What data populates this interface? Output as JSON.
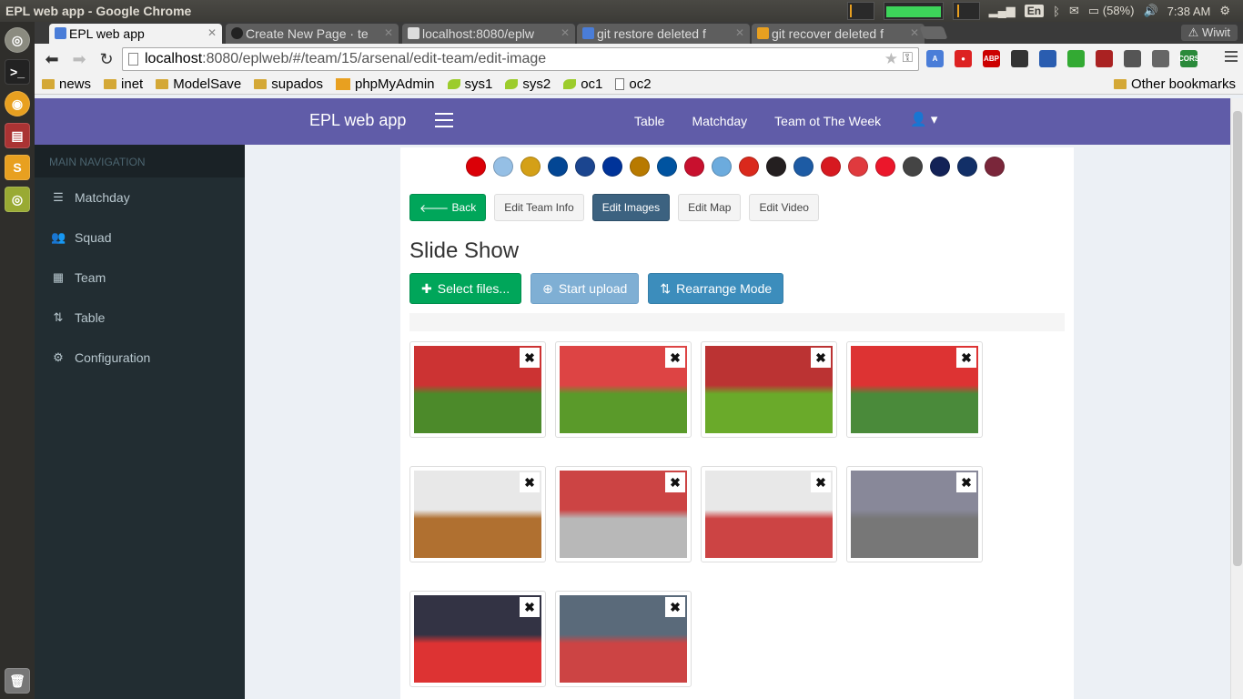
{
  "os": {
    "window_title": "EPL web app - Google Chrome",
    "lang": "En",
    "battery": "(58%)",
    "time": "7:38 AM"
  },
  "browser": {
    "tabs": [
      {
        "label": "EPL web app",
        "favicon_color": "#4a7dd8",
        "active": true
      },
      {
        "label": "Create New Page · te",
        "favicon_color": "#222222",
        "active": false
      },
      {
        "label": "localhost:8080/eplw",
        "favicon_color": "#dddddd",
        "active": false
      },
      {
        "label": "git restore deleted f",
        "favicon_color": "#4a7dd8",
        "active": false
      },
      {
        "label": "git recover deleted f",
        "favicon_color": "#e8a020",
        "active": false
      }
    ],
    "wiwit": "Wiwit",
    "url_host": "localhost",
    "url_rest": ":8080/eplweb/#/team/15/arsenal/edit-team/edit-image",
    "extensions": [
      {
        "name": "translate-icon",
        "color": "#4a7dd8",
        "text": "A"
      },
      {
        "name": "stop-icon",
        "color": "#d22",
        "text": "●"
      },
      {
        "name": "abp-icon",
        "color": "#c00",
        "text": "ABP"
      },
      {
        "name": "ext-dark-icon",
        "color": "#333",
        "text": ""
      },
      {
        "name": "screen-icon",
        "color": "#2a5db0",
        "text": ""
      },
      {
        "name": "colors-icon",
        "color": "#3a3",
        "text": ""
      },
      {
        "name": "hat-icon",
        "color": "#a22",
        "text": ""
      },
      {
        "name": "shield-icon",
        "color": "#555",
        "text": ""
      },
      {
        "name": "globe-icon",
        "color": "#666",
        "text": ""
      },
      {
        "name": "cors-icon",
        "color": "#2a8a3a",
        "text": "CORS"
      }
    ],
    "bookmarks": [
      {
        "label": "news",
        "icon": "folder"
      },
      {
        "label": "inet",
        "icon": "folder"
      },
      {
        "label": "ModelSave",
        "icon": "folder"
      },
      {
        "label": "supados",
        "icon": "folder"
      },
      {
        "label": "phpMyAdmin",
        "icon": "pma"
      },
      {
        "label": "sys1",
        "icon": "leaf"
      },
      {
        "label": "sys2",
        "icon": "leaf"
      },
      {
        "label": "oc1",
        "icon": "leaf"
      },
      {
        "label": "oc2",
        "icon": "page"
      }
    ],
    "other_bookmarks": "Other bookmarks"
  },
  "app": {
    "brand": "EPL web app",
    "topnav": [
      "Table",
      "Matchday",
      "Team ot The Week"
    ],
    "sidebar": {
      "header": "MAIN NAVIGATION",
      "items": [
        {
          "label": "Matchday",
          "icon": "list-icon",
          "glyph": "☰"
        },
        {
          "label": "Squad",
          "icon": "users-icon",
          "glyph": "👥"
        },
        {
          "label": "Team",
          "icon": "table-icon",
          "glyph": "▦"
        },
        {
          "label": "Table",
          "icon": "sort-icon",
          "glyph": "⇅"
        },
        {
          "label": "Configuration",
          "icon": "gear-icon",
          "glyph": "⚙"
        }
      ]
    },
    "team_badges": [
      {
        "name": "arsenal",
        "color": "#db0007"
      },
      {
        "name": "aston-villa",
        "color": "#95bfe5"
      },
      {
        "name": "burnley",
        "color": "#d4a017"
      },
      {
        "name": "chelsea",
        "color": "#034694"
      },
      {
        "name": "crystal-palace",
        "color": "#1b458f"
      },
      {
        "name": "everton",
        "color": "#003399"
      },
      {
        "name": "hull-city",
        "color": "#b87a00"
      },
      {
        "name": "leicester",
        "color": "#0053a0"
      },
      {
        "name": "liverpool",
        "color": "#c8102e"
      },
      {
        "name": "man-city",
        "color": "#6cabdd"
      },
      {
        "name": "man-united",
        "color": "#da291c"
      },
      {
        "name": "newcastle",
        "color": "#241f20"
      },
      {
        "name": "qpr",
        "color": "#1d5ba4"
      },
      {
        "name": "southampton",
        "color": "#d71920"
      },
      {
        "name": "stoke",
        "color": "#e03a3e"
      },
      {
        "name": "sunderland",
        "color": "#eb172b"
      },
      {
        "name": "swansea",
        "color": "#444444"
      },
      {
        "name": "tottenham",
        "color": "#132257"
      },
      {
        "name": "west-brom",
        "color": "#122f67"
      },
      {
        "name": "west-ham",
        "color": "#7a263a"
      }
    ],
    "tabs": {
      "back": "Back",
      "edit_team_info": "Edit Team Info",
      "edit_images": "Edit Images",
      "edit_map": "Edit Map",
      "edit_video": "Edit Video"
    },
    "slide_title": "Slide Show",
    "upload": {
      "select": "Select files...",
      "start": "Start upload",
      "rearrange": "Rearrange Mode"
    },
    "images": [
      {
        "name": "stadium-pitch-1",
        "top": "#c33",
        "bottom": "#4c8a2a"
      },
      {
        "name": "stadium-pitch-2",
        "top": "#d44",
        "bottom": "#5a9a2a"
      },
      {
        "name": "stadium-pitch-3",
        "top": "#b33",
        "bottom": "#6aaa2a"
      },
      {
        "name": "stadium-seats",
        "top": "#d33",
        "bottom": "#4a8a3a"
      },
      {
        "name": "press-room",
        "top": "#e8e8e8",
        "bottom": "#b07030"
      },
      {
        "name": "dressing-room-1",
        "top": "#c44",
        "bottom": "#b8b8b8"
      },
      {
        "name": "dressing-room-2",
        "top": "#e8e8e8",
        "bottom": "#c44"
      },
      {
        "name": "cannon-exterior",
        "top": "#889",
        "bottom": "#777"
      },
      {
        "name": "club-shop",
        "top": "#334",
        "bottom": "#d33"
      },
      {
        "name": "stadium-exterior",
        "top": "#5a6a7a",
        "bottom": "#c44"
      }
    ]
  }
}
